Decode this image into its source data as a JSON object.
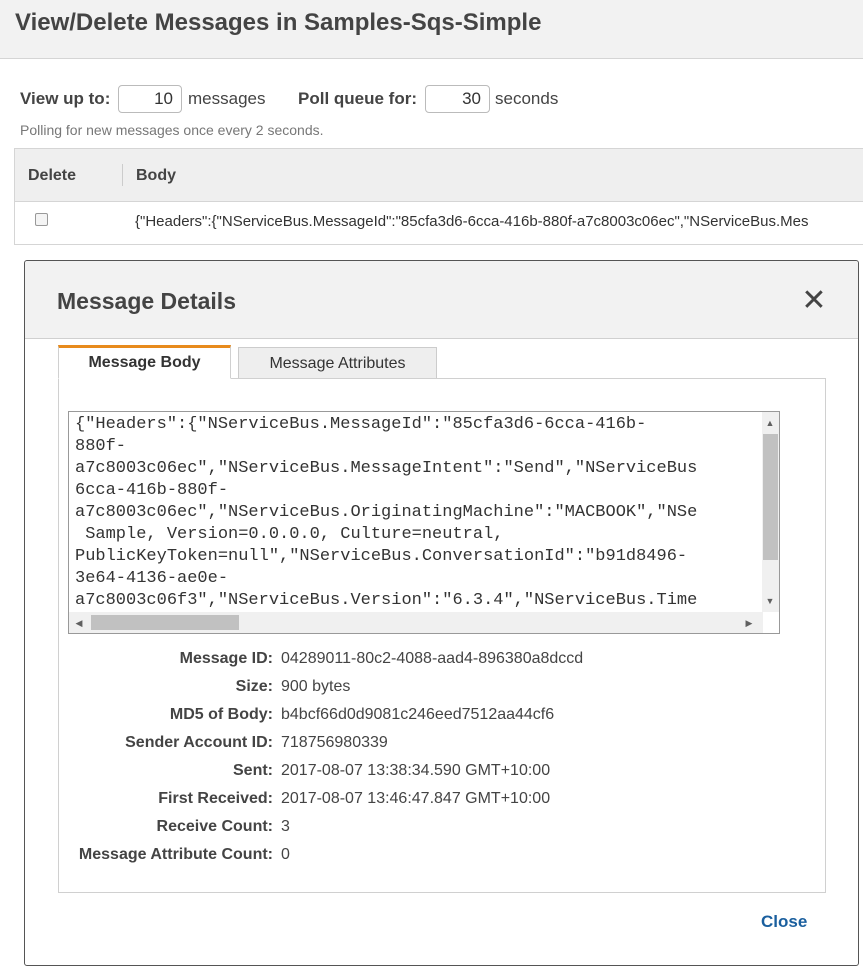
{
  "page": {
    "title": "View/Delete Messages in Samples-Sqs-Simple",
    "view_label": "View up to:",
    "view_value": "10",
    "view_suffix": "messages",
    "poll_label": "Poll queue for:",
    "poll_value": "30",
    "poll_suffix": "seconds",
    "poll_note": "Polling for new messages once every 2 seconds."
  },
  "table": {
    "columns": [
      "Delete",
      "Body"
    ],
    "rows": [
      {
        "body": "{\"Headers\":{\"NServiceBus.MessageId\":\"85cfa3d6-6cca-416b-880f-a7c8003c06ec\",\"NServiceBus.Mes"
      }
    ]
  },
  "modal": {
    "title": "Message Details",
    "close_symbol": "✕",
    "tabs": [
      {
        "label": "Message Body",
        "active": true
      },
      {
        "label": "Message Attributes",
        "active": false
      }
    ],
    "body_lines": [
      "{\"Headers\":{\"NServiceBus.MessageId\":\"85cfa3d6-6cca-416b-",
      "880f-",
      "a7c8003c06ec\",\"NServiceBus.MessageIntent\":\"Send\",\"NServiceBus",
      "6cca-416b-880f-",
      "a7c8003c06ec\",\"NServiceBus.OriginatingMachine\":\"MACBOOK\",\"NSe",
      " Sample, Version=0.0.0.0, Culture=neutral,",
      "PublicKeyToken=null\",\"NServiceBus.ConversationId\":\"b91d8496-",
      "3e64-4136-ae0e-",
      "a7c8003c06f3\",\"NServiceBus.Version\":\"6.3.4\",\"NServiceBus.Time"
    ],
    "details": [
      {
        "label": "Message ID:",
        "value": "04289011-80c2-4088-aad4-896380a8dccd"
      },
      {
        "label": "Size:",
        "value": "900 bytes"
      },
      {
        "label": "MD5 of Body:",
        "value": "b4bcf66d0d9081c246eed7512aa44cf6"
      },
      {
        "label": "Sender Account ID:",
        "value": "718756980339"
      },
      {
        "label": "Sent:",
        "value": "2017-08-07 13:38:34.590 GMT+10:00"
      },
      {
        "label": "First Received:",
        "value": "2017-08-07 13:46:47.847 GMT+10:00"
      },
      {
        "label": "Receive Count:",
        "value": "3"
      },
      {
        "label": "Message Attribute Count:",
        "value": "0"
      }
    ],
    "close_label": "Close"
  },
  "colors": {
    "active_tab_accent": "#e88b1c",
    "link": "#1a5f9e"
  }
}
